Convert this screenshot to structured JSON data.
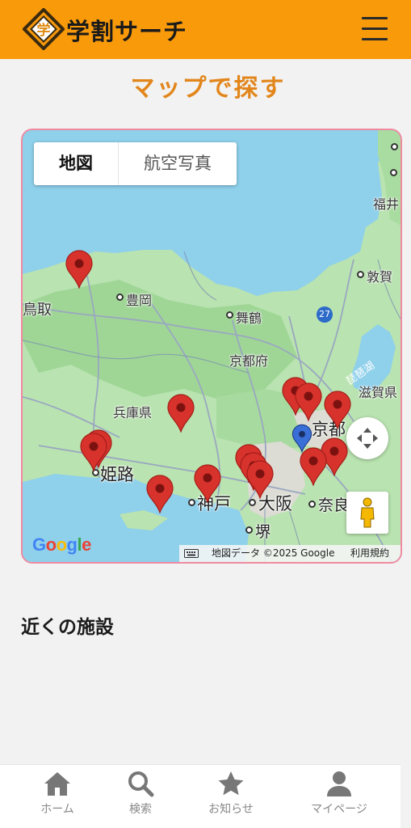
{
  "app": {
    "title": "学割サーチ",
    "logo_text": "学"
  },
  "header": {
    "menu_icon": "hamburger-menu-icon"
  },
  "page": {
    "title": "マップで探す"
  },
  "map": {
    "type_control": {
      "map_label": "地図",
      "satellite_label": "航空写真",
      "selected": "地図"
    },
    "labels": {
      "toyooka": "豊岡",
      "maizuru": "舞鶴",
      "kyoto_pref": "京都府",
      "hyogo_pref": "兵庫県",
      "himeji": "姫路",
      "kobe": "神戸",
      "osaka": "大阪",
      "sakai": "堺",
      "nara": "奈良",
      "kyoto": "京都",
      "shiga_pref": "滋賀県",
      "lake_biwa": "琵琶湖",
      "tsuruga": "敦賀",
      "fukui": "福井",
      "tottori": "鳥取",
      "route": "27"
    },
    "attribution": {
      "data": "地図データ ©2025 Google",
      "terms": "利用規約"
    },
    "google_logo": "Google",
    "marker_color": "#d8322c",
    "current_location_color": "#3b6fd8"
  },
  "nearby": {
    "title": "近くの施設"
  },
  "bottom_nav": [
    {
      "label": "ホーム",
      "icon": "home-icon"
    },
    {
      "label": "検索",
      "icon": "search-icon"
    },
    {
      "label": "お知らせ",
      "icon": "star-icon"
    },
    {
      "label": "マイページ",
      "icon": "person-icon"
    }
  ],
  "colors": {
    "header": "#f99a0a",
    "title": "#e2861c",
    "map_border": "#f08aa0"
  }
}
